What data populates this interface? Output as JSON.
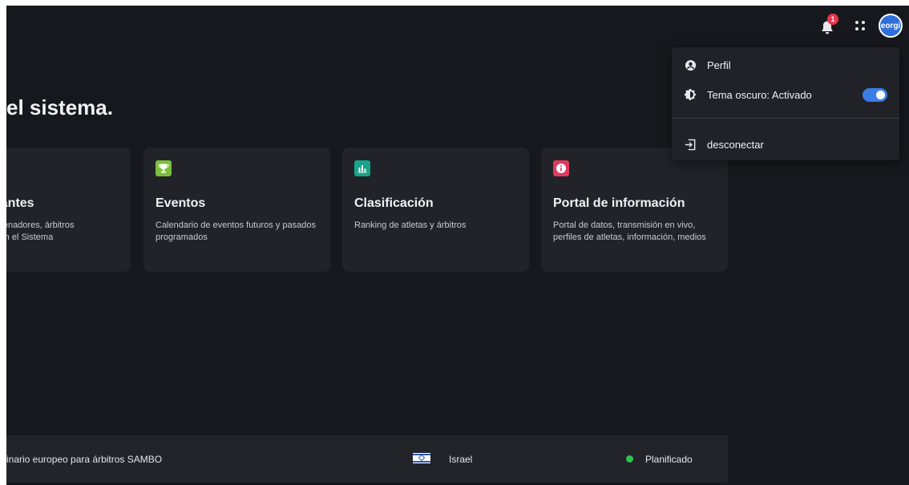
{
  "header": {
    "notifications_count": "1",
    "avatar_text": "eorgi"
  },
  "main": {
    "heading": "el sistema."
  },
  "cards": [
    {
      "title": "pantes",
      "desc_line1": "ntrenadores, árbitros",
      "desc_line2": "s en el Sistema"
    },
    {
      "title": "Eventos",
      "desc": "Calendario de eventos futuros y pasados programados",
      "icon": "trophy-icon",
      "color": "#7cbf3a"
    },
    {
      "title": "Clasificación",
      "desc": "Ranking de atletas y árbitros",
      "icon": "bar-chart-icon",
      "color": "#1aa38a"
    },
    {
      "title": "Portal de información",
      "desc": "Portal de datos, transmisión en vivo, perfiles de atletas, información, medios",
      "icon": "info-icon",
      "color": "#e03a5e"
    }
  ],
  "event_row": {
    "name": "inario europeo para árbitros SAMBO",
    "country": "Israel",
    "status": "Planificado",
    "status_color": "#2ec44f"
  },
  "user_menu": {
    "profile_label": "Perfil",
    "theme_label": "Tema oscuro: Activado",
    "theme_enabled": true,
    "logout_label": "desconectar"
  }
}
